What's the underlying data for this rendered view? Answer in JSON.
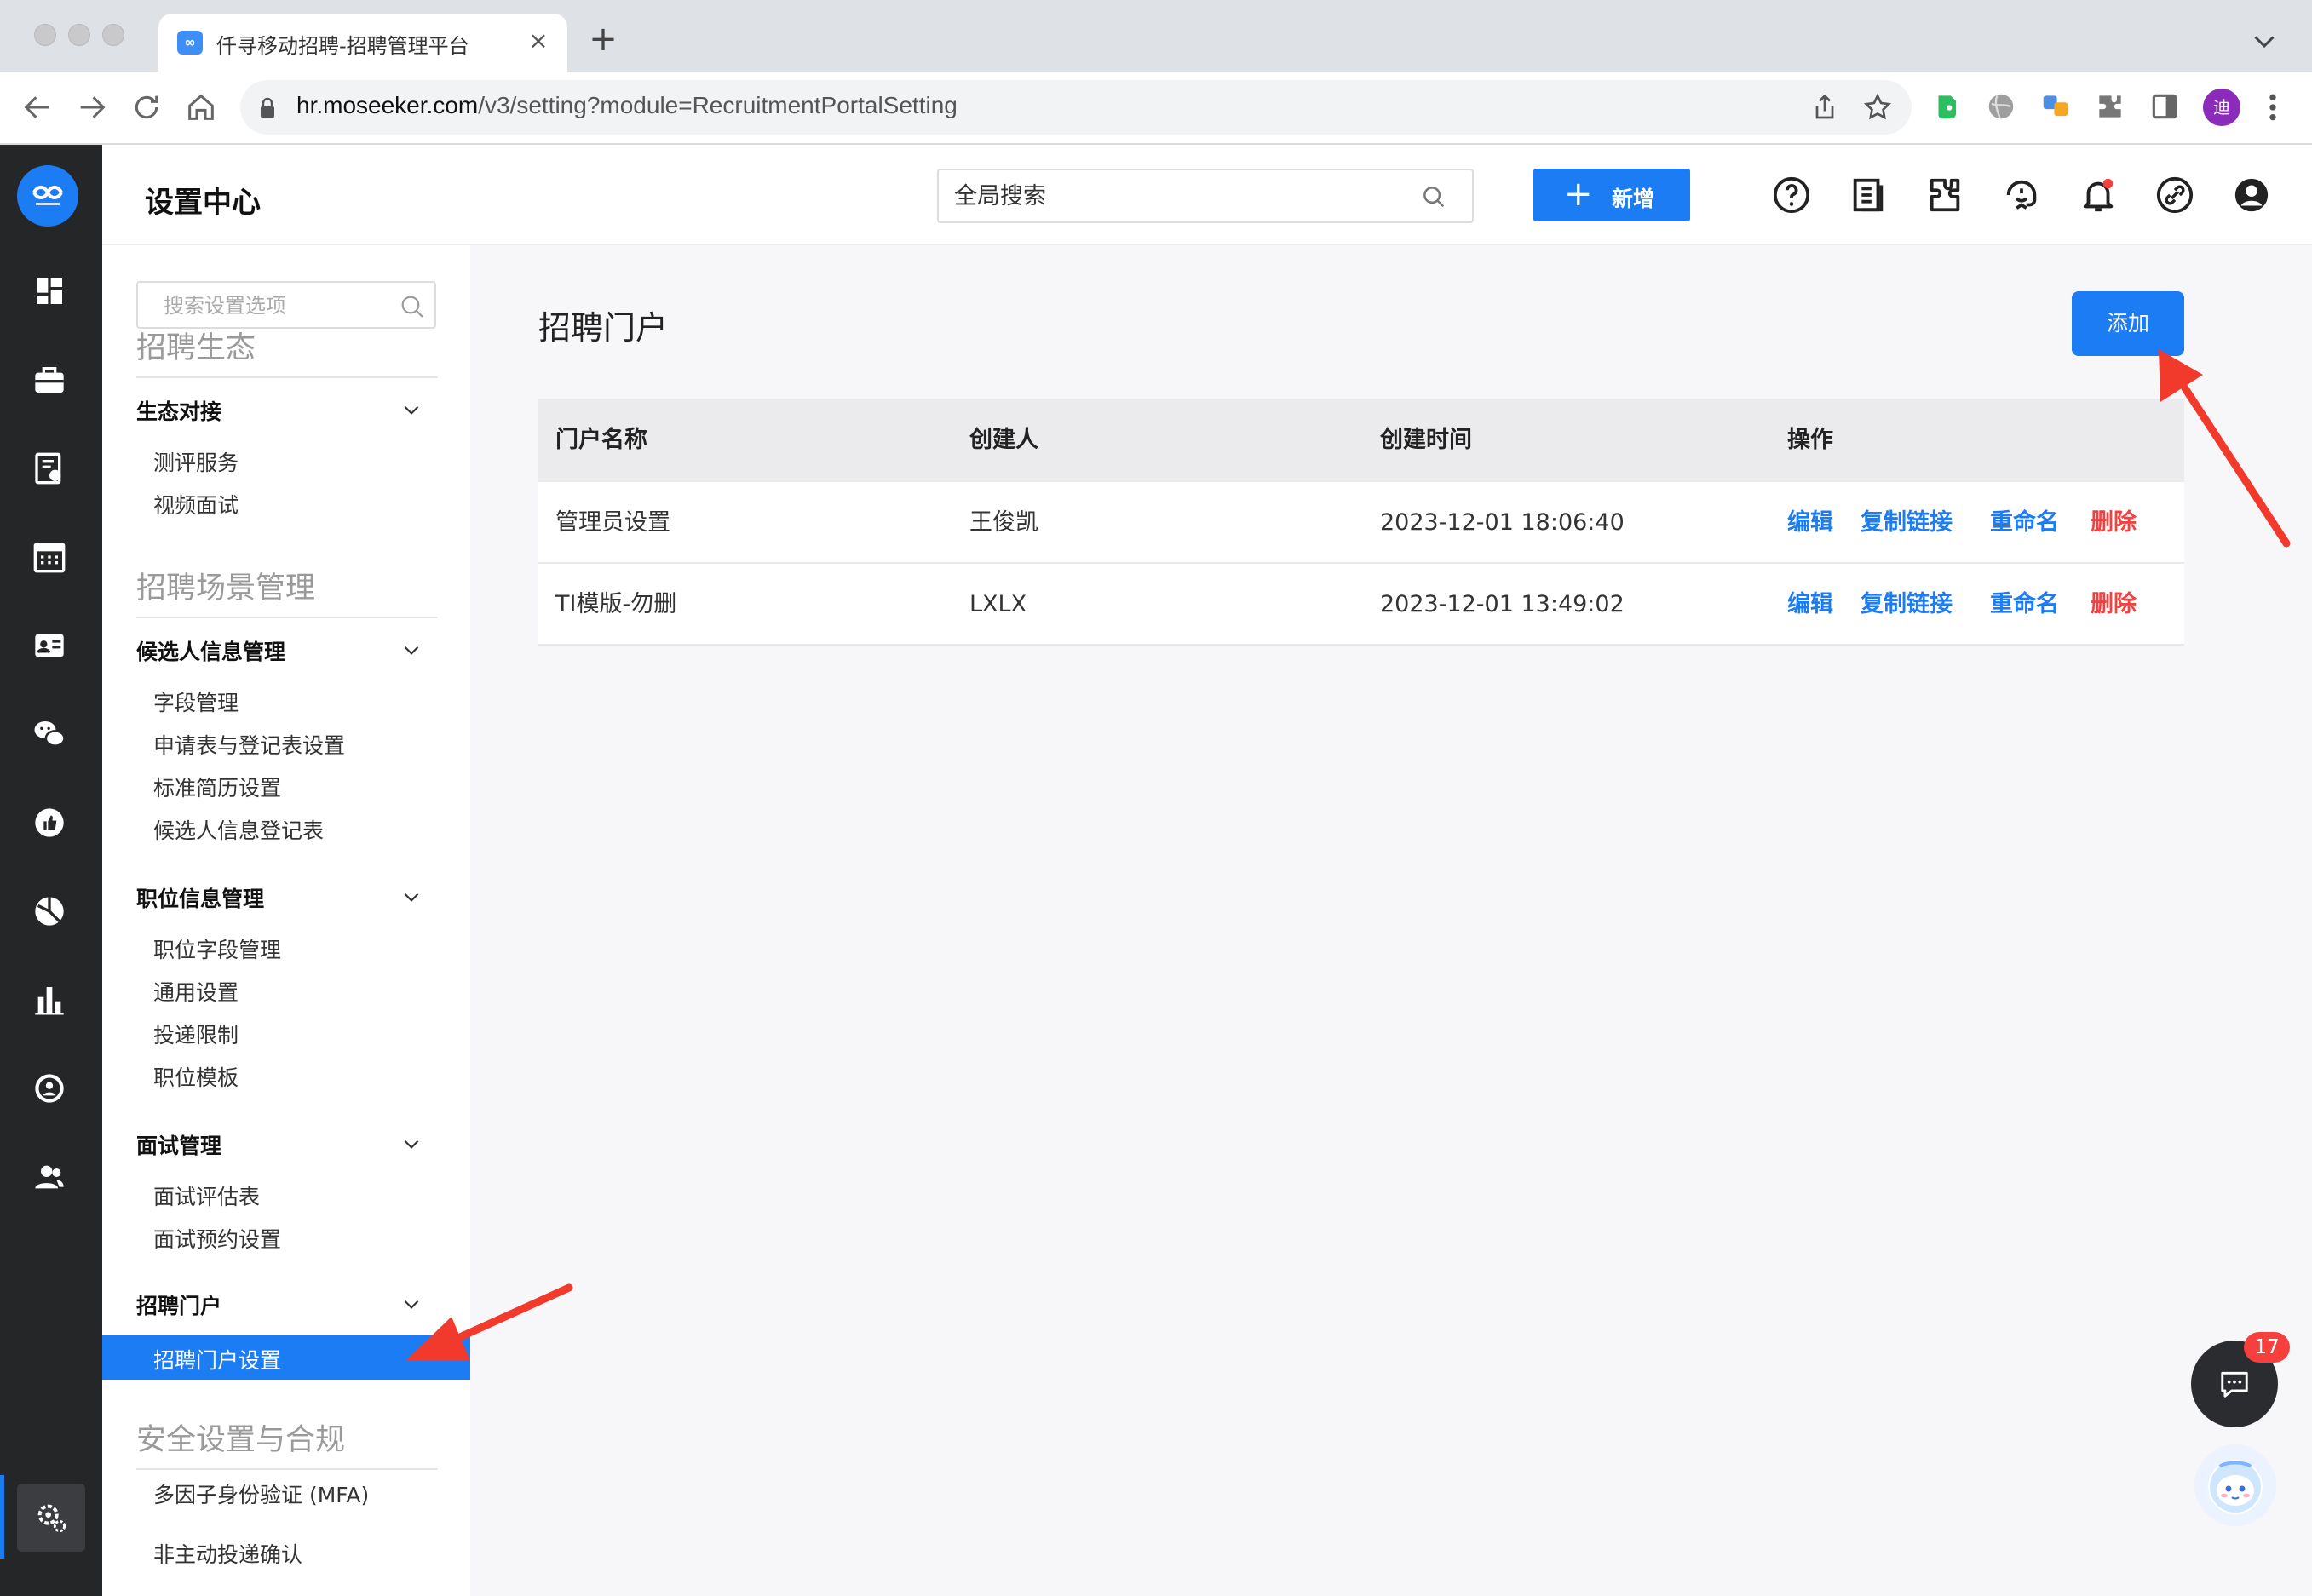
{
  "browser": {
    "tab_title": "仟寻移动招聘-招聘管理平台",
    "tab_close": "×",
    "new_tab": "+",
    "url_host": "hr.moseeker.com",
    "url_path": "/v3/setting?module=RecruitmentPortalSetting",
    "profile_initial": "迪"
  },
  "header": {
    "title": "设置中心",
    "search_placeholder": "全局搜索",
    "new_button": "新增",
    "new_button_icon": "+",
    "icons": [
      "help-icon",
      "document-icon",
      "puzzle-icon",
      "support-icon",
      "bell-icon",
      "link-icon",
      "user-icon"
    ]
  },
  "rail": {
    "icons": [
      "dashboard-icon",
      "briefcase-icon",
      "resume-icon",
      "calendar-icon",
      "id-card-icon",
      "wechat-icon",
      "thumbs-up-icon",
      "pie-chart-icon",
      "bar-chart-icon",
      "person-circle-icon",
      "team-icon"
    ],
    "active_icon": "settings-gear-icon"
  },
  "sidebar": {
    "search_placeholder": "搜索设置选项",
    "sections": [
      {
        "title": "招聘生态",
        "groups": [
          {
            "title": "生态对接",
            "items": [
              "测评服务",
              "视频面试"
            ]
          }
        ]
      },
      {
        "title": "招聘场景管理",
        "groups": [
          {
            "title": "候选人信息管理",
            "items": [
              "字段管理",
              "申请表与登记表设置",
              "标准简历设置",
              "候选人信息登记表"
            ]
          },
          {
            "title": "职位信息管理",
            "items": [
              "职位字段管理",
              "通用设置",
              "投递限制",
              "职位模板"
            ]
          },
          {
            "title": "面试管理",
            "items": [
              "面试评估表",
              "面试预约设置"
            ]
          },
          {
            "title": "招聘门户",
            "items": [
              "招聘门户设置"
            ]
          }
        ]
      },
      {
        "title": "安全设置与合规",
        "items": [
          "多因子身份验证 (MFA)",
          "非主动投递确认"
        ]
      }
    ],
    "active_item": "招聘门户设置"
  },
  "main": {
    "heading": "招聘门户",
    "add_button": "添加",
    "table": {
      "columns": [
        "门户名称",
        "创建人",
        "创建时间",
        "操作"
      ],
      "rows": [
        {
          "name": "管理员设置",
          "creator": "王俊凯",
          "created": "2023-12-01 18:06:40"
        },
        {
          "name": "TI模版-勿删",
          "creator": "LXLX",
          "created": "2023-12-01 13:49:02"
        }
      ],
      "actions": [
        "编辑",
        "复制链接",
        "重命名",
        "删除"
      ]
    }
  },
  "widgets": {
    "chat_badge": "17"
  },
  "colors": {
    "primary": "#1c7cf4",
    "danger": "#f5403d",
    "rail_bg": "#252628",
    "annotation_arrow": "#f23a2c"
  }
}
